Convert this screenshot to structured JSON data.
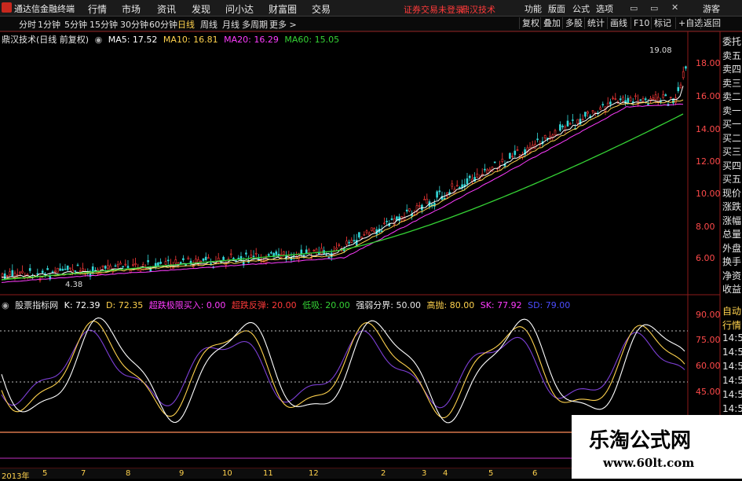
{
  "app_title": "通达信金融终端",
  "menu": [
    "行情",
    "市场",
    "资讯",
    "发现",
    "问小达",
    "财富圈",
    "交易"
  ],
  "header_links": {
    "trade_status": "证券交易未登录",
    "stock_name": "鼎汉技术"
  },
  "top_right": [
    "功能",
    "版面",
    "公式",
    "选项",
    "游客"
  ],
  "timeframes": [
    "分时",
    "1分钟",
    "5分钟",
    "15分钟",
    "30分钟",
    "60分钟",
    "日线",
    "周线",
    "月线",
    "多周期",
    "更多 >"
  ],
  "active_timeframe": "日线",
  "tool_buttons": [
    "复权",
    "叠加",
    "多股",
    "统计",
    "画线",
    "F10",
    "标记",
    "+自选",
    "返回"
  ],
  "main_legend": {
    "title": "鼎汉技术(日线 前复权)",
    "ma5": "MA5: 17.52",
    "ma10": "MA10: 16.81",
    "ma20": "MA20: 16.29",
    "ma60": "MA60: 15.05"
  },
  "price_axis": [
    "18.00",
    "16.00",
    "14.00",
    "12.00",
    "10.00",
    "8.00",
    "6.00"
  ],
  "price_annotations": {
    "high": "19.08",
    "low": "4.38"
  },
  "indicator_legend": {
    "name": "股票指标网",
    "k": "K: 72.39",
    "d": "D: 72.35",
    "oversold_buy": "超跌极限买入: 0.00",
    "oversold_rebound": "超跌反弹: 20.00",
    "low_level": "低吸: 20.00",
    "strength_line": "强弱分界: 50.00",
    "high_sell": "高抛: 80.00",
    "sk": "SK: 77.92",
    "sd": "SD: 79.00"
  },
  "indicator_axis": [
    "90.00",
    "75.00",
    "60.00",
    "45.00"
  ],
  "right_panel_top": [
    "委托",
    "卖五",
    "卖四",
    "卖三",
    "卖二",
    "卖一",
    "买一",
    "买二",
    "买三",
    "买四",
    "买五",
    "现价",
    "涨跌",
    "涨幅",
    "总量",
    "外盘",
    "换手",
    "净资",
    "收益"
  ],
  "right_panel_bottom": [
    "自动",
    "行情",
    "14:50",
    "14:50",
    "14:50",
    "14:50",
    "14:50",
    "14:50",
    "14:50"
  ],
  "date_axis": [
    "2013年",
    "5",
    "7",
    "8",
    "9",
    "10",
    "11",
    "12",
    "2",
    "3",
    "4",
    "5",
    "6",
    "7"
  ],
  "watermark": {
    "cn": "乐淘公式网",
    "url": "www.60lt.com"
  },
  "colors": {
    "ma5": "#ffffff",
    "ma10": "#ffd24d",
    "ma20": "#ff3cff",
    "ma60": "#35d335",
    "k": "#ffffff",
    "d": "#ffd24d",
    "axis": "#ff3a3a"
  }
}
